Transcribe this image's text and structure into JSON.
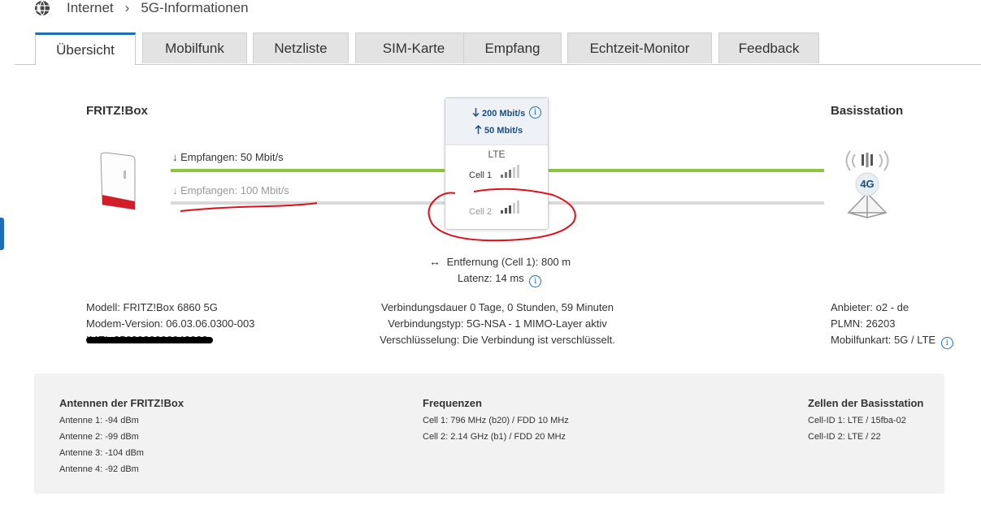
{
  "breadcrumb": {
    "root": "Internet",
    "separator": "›",
    "current": "5G-Informationen"
  },
  "tabs": [
    {
      "label": "Übersicht",
      "active": true
    },
    {
      "label": "Mobilfunk"
    },
    {
      "label": "Netzliste"
    },
    {
      "label": "SIM-Karte"
    },
    {
      "label": "Empfang"
    },
    {
      "label": "Echtzeit-Monitor"
    },
    {
      "label": "Feedback"
    }
  ],
  "diagram": {
    "left_title": "FRITZ!Box",
    "right_title": "Basisstation",
    "cell1_label": "↓ Empfangen: 50 Mbit/s",
    "cell2_label": "↓ Empfangen: 100 Mbit/s",
    "station_badge": "4G",
    "distance": "Entfernung (Cell 1): 800 m",
    "latency": "Latenz: 14 ms"
  },
  "popup": {
    "down": "200 Mbit/s",
    "up": "50 Mbit/s",
    "tech": "LTE",
    "cell1": "Cell 1",
    "cell2": "Cell 2"
  },
  "device_info": {
    "model": "Modell: FRITZ!Box 6860 5G",
    "modem_version": "Modem-Version: 06.03.06.0300-003",
    "imei_redacted": "IMEI: 3563920000042033"
  },
  "connection_info": {
    "duration": "Verbindungsdauer 0 Tage, 0 Stunden, 59 Minuten",
    "type": "Verbindungstyp: 5G-NSA - 1 MIMO-Layer aktiv",
    "encryption": "Verschlüsselung: Die Verbindung ist verschlüsselt."
  },
  "provider_info": {
    "provider": "Anbieter: o2 - de",
    "plmn": "PLMN: 26203",
    "card": "Mobilfunkart: 5G / LTE"
  },
  "antennas": {
    "title": "Antennen der FRITZ!Box",
    "items": [
      "Antenne 1: -94 dBm",
      "Antenne 2: -99 dBm",
      "Antenne 3: -104 dBm",
      "Antenne 4: -92 dBm"
    ]
  },
  "frequencies": {
    "title": "Frequenzen",
    "items": [
      "Cell 1: 796 MHz (b20) / FDD 10 MHz",
      "Cell 2: 2.14 GHz (b1) / FDD 20 MHz"
    ]
  },
  "cells": {
    "title": "Zellen der Basisstation",
    "items": [
      "Cell-ID 1: LTE / 15fba-02",
      "Cell-ID 2: LTE / 22"
    ]
  },
  "colors": {
    "accent": "#1e6fb7",
    "active_link": "#8cc63f",
    "inactive_link": "#d9d9d9",
    "annotation_red": "#e0101a"
  }
}
